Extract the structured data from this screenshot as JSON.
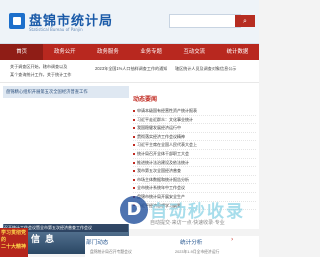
{
  "header": {
    "site_name": "盘锦市统计局",
    "site_name_en": "Statistical Bureau of Panjin"
  },
  "nav": {
    "items": [
      "首页",
      "政务公开",
      "政务服务",
      "业务专题",
      "互动交流",
      "统计数据"
    ]
  },
  "notice": {
    "left_line1": "关于调查区开始，辖市调查以及",
    "left_line2": "某个查询统计工作，关于统计工作",
    "mid_line": "2023年全国1%人口抽样调查工作的通知",
    "right_line": "辖区统计人员及调查对象信息公示"
  },
  "banner": {
    "text": "盘锦精心组织开展第五次全国经济普查工作"
  },
  "news": {
    "header": "动态要闻",
    "items": [
      "申请本级国有经营性资产统计报表",
      "习近平走近群众：文化事业统计",
      "我国稳健发展经济运行中",
      "贯彻落实经济工作会议精神",
      "习近平主席在全国人民代表大会上",
      "统计局召开全体干部职工大会",
      "推进统计法治建设及依法统计",
      "我市第五次全国经济普查",
      "市场主体数据和统计报告分析",
      "全市统计系统年中工作会议",
      "盘锦市统计局开展安全生产",
      "习近平经济思想学习纲要"
    ]
  },
  "photo": {
    "caption": "召开统计工作会议暨全市第五次经济普查工作会议",
    "title": "统计信息"
  },
  "badge": {
    "line1": "学习贯彻党的",
    "line2": "二十大精神"
  },
  "bottom": {
    "tab_a": "部门动态",
    "tab_b": "统计分析",
    "list_a": "盘锦统计局召开专题会议",
    "list_b": "2023年1-9月全市经济运行"
  },
  "watermark": {
    "text": "自动秒收录",
    "sub": "自动提交·来访一点·快速收录·专业"
  }
}
